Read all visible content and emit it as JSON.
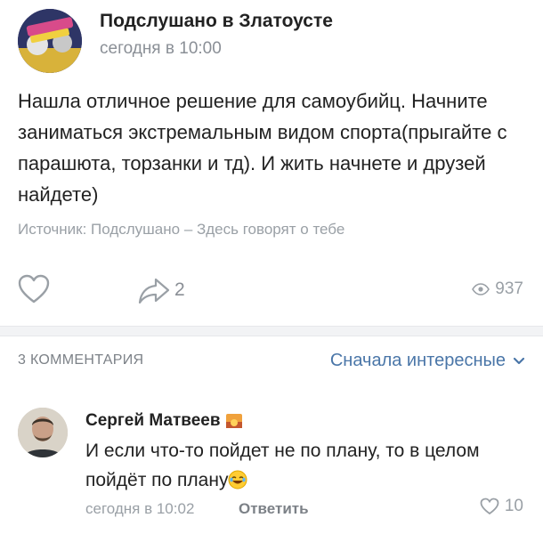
{
  "post": {
    "group_name": "Подслушано в Златоусте",
    "time": "сегодня в 10:00",
    "text": "Нашла отличное решение для самоубийц. Начните заниматься экстремальным видом спорта(прыгайте с парашюта, торзанки и тд). И жить начнете и друзей найдете)",
    "source": "Источник: Подслушано – Здесь говорят о тебе",
    "shares": "2",
    "views": "937"
  },
  "comments_section": {
    "header": "3 КОММЕНТАРИЯ",
    "sort_label": "Сначала интересные"
  },
  "comment": {
    "author": "Сергей Матвеев",
    "text": "И если что-то пойдет не по плану, то в целом пойдёт по плану",
    "time": "сегодня в 10:02",
    "reply_label": "Ответить",
    "likes": "10"
  },
  "colors": {
    "accent": "#4a76a8",
    "muted": "#9aa0a6"
  }
}
